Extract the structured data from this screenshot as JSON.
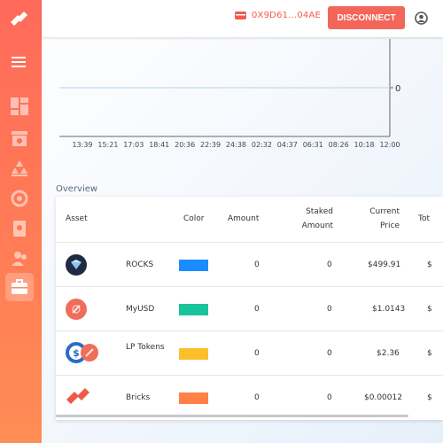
{
  "header": {
    "wallet_address": "0X9D61...04AE",
    "disconnect_label": "DISCONNECT"
  },
  "chart_data": {
    "type": "line",
    "x": [
      "13:39",
      "15:21",
      "17:03",
      "18:41",
      "20:36",
      "22:39",
      "24:38",
      "02:32",
      "04:37",
      "06:31",
      "08:26",
      "10:18",
      "12:00"
    ],
    "series": [
      {
        "values": [
          0,
          0,
          0,
          0,
          0,
          0,
          0,
          0,
          0,
          0,
          0,
          0,
          0
        ]
      }
    ],
    "yticks": [
      "0"
    ],
    "title": "",
    "xlabel": "",
    "ylabel": "",
    "color": "#b8d4e8"
  },
  "overview": {
    "title": "Overview",
    "columns": [
      "Asset",
      "Color",
      "Amount",
      "Staked Amount",
      "Current Price",
      "Tot"
    ],
    "rows": [
      {
        "name": "ROCKS",
        "color": "#1a8cff",
        "amount": "0",
        "staked": "0",
        "price": "$499.91",
        "icon": "rocks-icon"
      },
      {
        "name": "MyUSD",
        "color": "#19c49a",
        "amount": "0",
        "staked": "0",
        "price": "$1.0143",
        "icon": "myusd-icon"
      },
      {
        "name": "LP Tokens",
        "color": "#fbbf2c",
        "amount": "0",
        "staked": "0",
        "price": "$2.36",
        "icon": "lp-tokens-icon"
      },
      {
        "name": "Bricks",
        "color": "#ff8147",
        "amount": "0",
        "staked": "0",
        "price": "$0.00012",
        "icon": "bricks-icon"
      }
    ],
    "total_partial": [
      "$",
      "$",
      "$",
      "$"
    ]
  },
  "sidebar": {
    "items": [
      "logo-icon",
      "menu-icon",
      "dashboard-icon",
      "bank-icon",
      "stake-icon",
      "exchange-icon",
      "document-icon",
      "users-icon",
      "briefcase-icon"
    ]
  }
}
